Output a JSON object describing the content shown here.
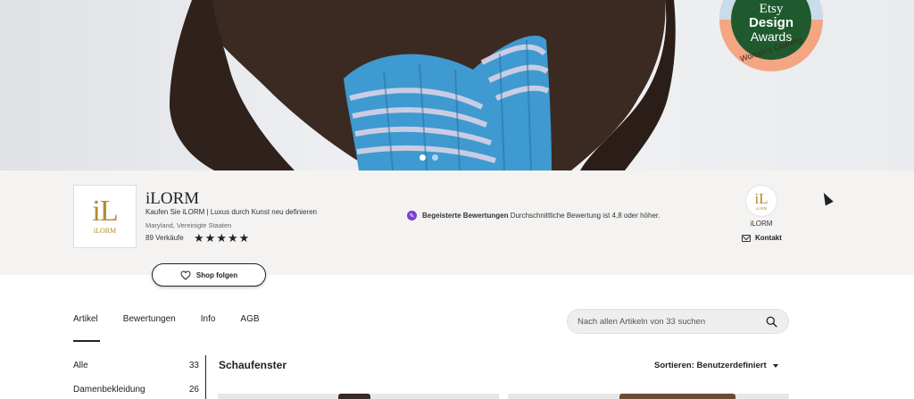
{
  "banner": {
    "carousel_dots": 2,
    "award": {
      "line1": "Etsy",
      "line2": "Design",
      "line3": "Awards",
      "category": "Women's Clothing",
      "colors": {
        "outer": "#f4a582",
        "inner": "#1f5a2e",
        "top": "#c9dceb"
      }
    }
  },
  "shop": {
    "logo_text": "iL",
    "logo_subtext": "iLORM",
    "name": "iLORM",
    "tagline": "Kaufen Sie iLORM | Luxus durch Kunst neu definieren",
    "location": "Maryland, Vereinigte Staaten",
    "sales": "89 Verkäufe",
    "rating_stars": 5,
    "review_highlight": {
      "icon": "review-badge-icon",
      "bold": "Begeisterte Bewertungen",
      "text": "Durchschnittliche Bewertung ist 4,8 oder höher."
    },
    "owner": {
      "name": "iLORM",
      "contact_label": "Kontakt"
    },
    "follow_label": "Shop folgen"
  },
  "tabs": {
    "items": [
      "Artikel",
      "Bewertungen",
      "Info",
      "AGB"
    ],
    "active": "Artikel"
  },
  "search": {
    "placeholder": "Nach allen Artikeln von 33 suchen"
  },
  "sidebar": {
    "categories": [
      {
        "label": "Alle",
        "count": "33"
      },
      {
        "label": "Damenbekleidung",
        "count": "26"
      }
    ]
  },
  "main": {
    "section_title": "Schaufenster",
    "sort_label": "Sortieren: Benutzerdefiniert"
  }
}
